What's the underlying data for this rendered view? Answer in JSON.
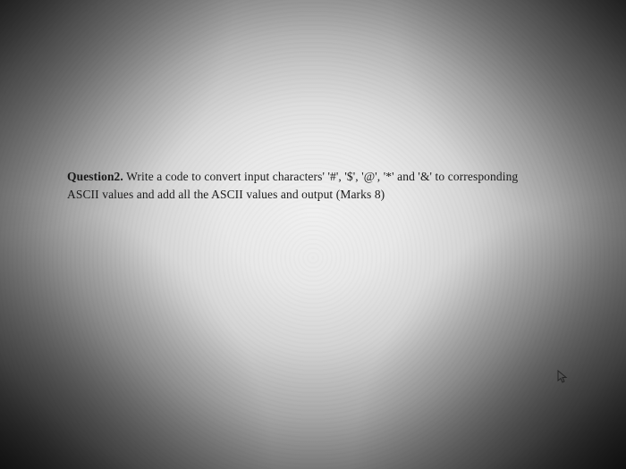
{
  "question": {
    "label": "Question2.",
    "body_line1": "Write a code to convert input characters' '#', '$', '@', '*' and '&' to corresponding",
    "body_line2": "ASCII values and add all the ASCII values and output (Marks 8)"
  }
}
